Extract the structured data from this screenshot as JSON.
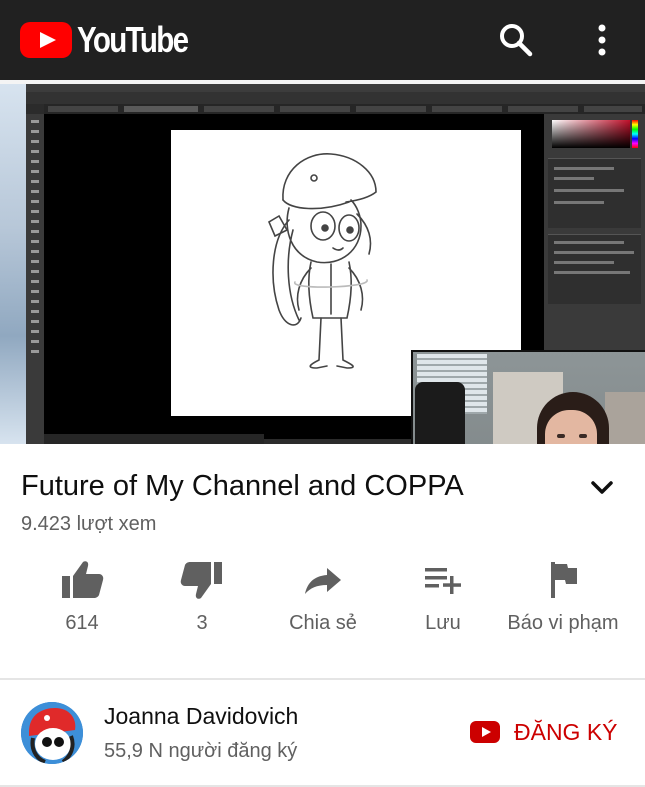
{
  "app": {
    "logo_text": "YouTube",
    "brand_color": "#ff0000",
    "search_icon": "search-icon",
    "menu_icon": "more-vert-icon"
  },
  "video": {
    "title": "Future of My Channel and COPPA",
    "views": "9.423 lượt xem",
    "expand_icon": "chevron-down-icon"
  },
  "actions": [
    {
      "icon": "thumb-up-icon",
      "label": "614"
    },
    {
      "icon": "thumb-down-icon",
      "label": "3"
    },
    {
      "icon": "share-icon",
      "label": "Chia sẻ"
    },
    {
      "icon": "playlist-add-icon",
      "label": "Lưu"
    },
    {
      "icon": "flag-icon",
      "label": "Báo vi phạm"
    }
  ],
  "channel": {
    "name": "Joanna Davidovich",
    "subscribers": "55,9 N người đăng ký",
    "subscribe_label": "ĐĂNG KÝ",
    "subscribe_color": "#cc0000"
  }
}
